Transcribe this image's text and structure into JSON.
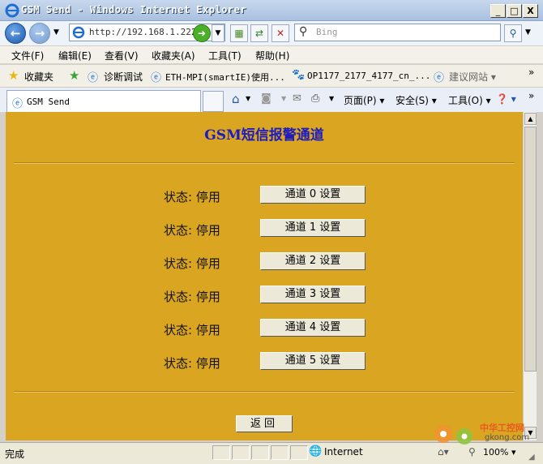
{
  "window": {
    "title": "GSM Send - Windows Internet Explorer",
    "min": "_",
    "max": "□",
    "close": "X"
  },
  "addressbar": {
    "url": "http://192.168.1.222/",
    "search_placeholder": "Bing"
  },
  "menu": [
    "文件(F)",
    "编辑(E)",
    "查看(V)",
    "收藏夹(A)",
    "工具(T)",
    "帮助(H)"
  ],
  "favorites": {
    "label": "收藏夹",
    "items": [
      "诊断调试",
      "ETH-MPI(smartIE)使用...",
      "OP1177_2177_4177_cn_...",
      "建议网站 ▾"
    ]
  },
  "tab": {
    "title": "GSM Send"
  },
  "commandbar": {
    "page": "页面(P) ▾",
    "safety": "安全(S) ▾",
    "tools": "工具(O) ▾",
    "help": "❓ ▾"
  },
  "page": {
    "title": "GSM短信报警通道",
    "channels": [
      {
        "status": "状态: 停用",
        "button": "通道 0 设置"
      },
      {
        "status": "状态: 停用",
        "button": "通道 1 设置"
      },
      {
        "status": "状态: 停用",
        "button": "通道 2 设置"
      },
      {
        "status": "状态: 停用",
        "button": "通道 3 设置"
      },
      {
        "status": "状态: 停用",
        "button": "通道 4 设置"
      },
      {
        "status": "状态: 停用",
        "button": "通道 5 设置"
      }
    ],
    "back_label": "返回"
  },
  "statusbar": {
    "text": "完成",
    "zone": "Internet",
    "zoom": "100% ▾"
  },
  "watermark": {
    "line1": "中华工控网",
    "line2": "gkong.com"
  },
  "colors": {
    "content_bg": "#daa521",
    "title": "#1c1cbf"
  }
}
